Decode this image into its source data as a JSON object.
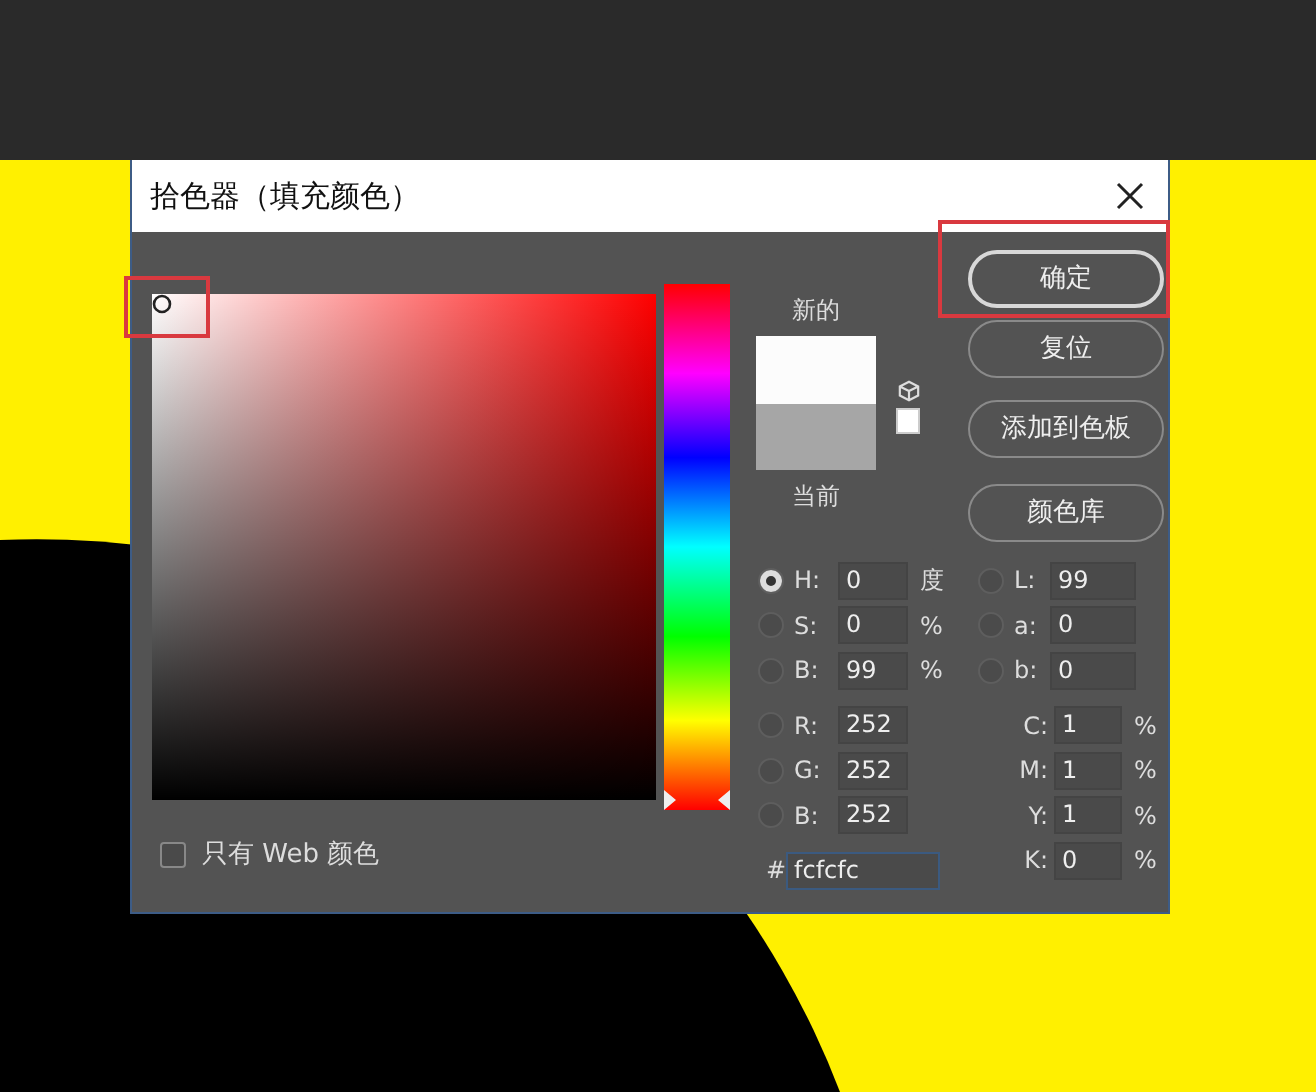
{
  "dialog": {
    "title": "拾色器（填充颜色）",
    "buttons": [
      {
        "label": "确定",
        "default": true
      },
      {
        "label": "复位",
        "default": false
      },
      {
        "label": "添加到色板",
        "default": false
      },
      {
        "label": "颜色库",
        "default": false
      }
    ],
    "hue_slider": {
      "level": 0
    },
    "new_label": "新的",
    "current_label": "当前",
    "hsb": [
      {
        "label": "H:",
        "value": "0",
        "unit": "度",
        "selected": true
      },
      {
        "label": "S:",
        "value": "0",
        "unit": "%",
        "selected": false
      },
      {
        "label": "B:",
        "value": "99",
        "unit": "%",
        "selected": false
      }
    ],
    "lab": [
      {
        "label": "L:",
        "value": "99",
        "selected": false
      },
      {
        "label": "a:",
        "value": "0",
        "selected": false
      },
      {
        "label": "b:",
        "value": "0",
        "selected": false
      }
    ],
    "rgb": [
      {
        "label": "R:",
        "value": "252",
        "selected": false
      },
      {
        "label": "G:",
        "value": "252",
        "selected": false
      },
      {
        "label": "B:",
        "value": "252",
        "selected": false
      }
    ],
    "hex": {
      "label": "#",
      "value": "fcfcfc"
    },
    "cmyk": [
      {
        "label": "C:",
        "value": "1",
        "unit": "%"
      },
      {
        "label": "M:",
        "value": "1",
        "unit": "%"
      },
      {
        "label": "Y:",
        "value": "1",
        "unit": "%"
      },
      {
        "label": "K:",
        "value": "0",
        "unit": "%"
      }
    ],
    "web_only": {
      "label": "只有 Web 颜色",
      "checked": false
    }
  }
}
